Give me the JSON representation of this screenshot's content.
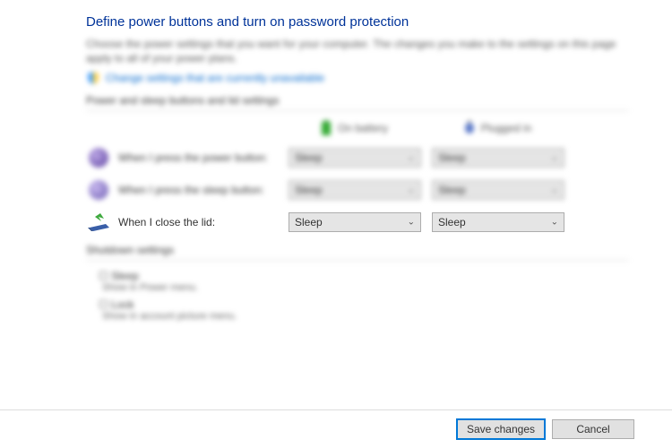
{
  "title": "Define power buttons and turn on password protection",
  "description": "Choose the power settings that you want for your computer. The changes you make to the settings on this page apply to all of your power plans.",
  "change_link": "Change settings that are currently unavailable",
  "section_buttons_header": "Power and sleep buttons and lid settings",
  "columns": {
    "battery": "On battery",
    "plugged": "Plugged in"
  },
  "rows": {
    "power_button": {
      "label": "When I press the power button:",
      "battery": "Sleep",
      "plugged": "Sleep"
    },
    "sleep_button": {
      "label": "When I press the sleep button:",
      "battery": "Sleep",
      "plugged": "Sleep"
    },
    "lid": {
      "label": "When I close the lid:",
      "battery": "Sleep",
      "plugged": "Sleep"
    }
  },
  "shutdown": {
    "header": "Shutdown settings",
    "sleep_label": "Sleep",
    "sleep_sub": "Show in Power menu.",
    "lock_label": "Lock",
    "lock_sub": "Show in account picture menu."
  },
  "footer": {
    "save": "Save changes",
    "cancel": "Cancel"
  }
}
